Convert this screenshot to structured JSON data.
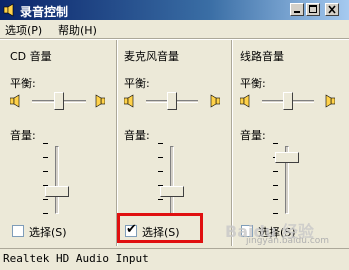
{
  "window": {
    "title": "录音控制"
  },
  "menu": {
    "options": "选项(P)",
    "help": "帮助(H)"
  },
  "channels": [
    {
      "title": "CD 音量",
      "balance_label": "平衡:",
      "volume_label": "音量:",
      "select_label": "选择(S)",
      "selected": false,
      "volume_level": 0.3
    },
    {
      "title": "麦克风音量",
      "balance_label": "平衡:",
      "volume_label": "音量:",
      "select_label": "选择(S)",
      "selected": true,
      "volume_level": 0.3
    },
    {
      "title": "线路音量",
      "balance_label": "平衡:",
      "volume_label": "音量:",
      "select_label": "选择(S)",
      "selected": false,
      "volume_level": 0.9
    }
  ],
  "status": "Realtek HD Audio Input",
  "watermark": {
    "text": "Baidu 经验",
    "sub": "jingyan.baidu.com"
  },
  "colors": {
    "highlight": "#e01010",
    "titlebar": "#0a246a"
  }
}
